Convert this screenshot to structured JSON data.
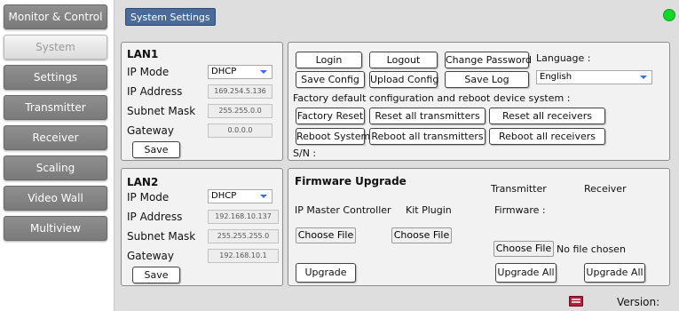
{
  "sidebar": {
    "items": [
      {
        "label": "Monitor & Control"
      },
      {
        "label": "System"
      },
      {
        "label": "Settings"
      },
      {
        "label": "Transmitter"
      },
      {
        "label": "Receiver"
      },
      {
        "label": "Scaling"
      },
      {
        "label": "Video Wall"
      },
      {
        "label": "Multiview"
      }
    ],
    "active": "System"
  },
  "header": {
    "title": "System Settings",
    "status_color": "#16d62a"
  },
  "lan1": {
    "title": "LAN1",
    "ip_mode_label": "IP Mode",
    "ip_mode_value": "DHCP",
    "ip_address_label": "IP Address",
    "ip_address_value": "169.254.5.136",
    "subnet_mask_label": "Subnet Mask",
    "subnet_mask_value": "255.255.0.0",
    "gateway_label": "Gateway",
    "gateway_value": "0.0.0.0",
    "save_label": "Save"
  },
  "lan2": {
    "title": "LAN2",
    "ip_mode_label": "IP Mode",
    "ip_mode_value": "DHCP",
    "ip_address_label": "IP Address",
    "ip_address_value": "192.168.10.137",
    "subnet_mask_label": "Subnet Mask",
    "subnet_mask_value": "255.255.255.0",
    "gateway_label": "Gateway",
    "gateway_value": "192.168.10.1",
    "save_label": "Save"
  },
  "account": {
    "login_label": "Login",
    "logout_label": "Logout",
    "change_password_label": "Change Password",
    "language_label": "Language :",
    "language_value": "English",
    "save_config_label": "Save Config",
    "upload_config_label": "Upload Config",
    "save_log_label": "Save Log",
    "factory_text": "Factory default configuration and reboot device system :",
    "factory_reset_label": "Factory Reset",
    "reset_tx_label": "Reset all transmitters",
    "reset_rx_label": "Reset all receivers",
    "reboot_system_label": "Reboot System",
    "reboot_tx_label": "Reboot all transmitters",
    "reboot_rx_label": "Reboot all receivers",
    "sn_label": "S/N :"
  },
  "firmware": {
    "title": "Firmware Upgrade",
    "transmitter_label": "Transmitter",
    "receiver_label": "Receiver",
    "ip_master_label": "IP Master Controller",
    "kit_plugin_label": "Kit Plugin",
    "firmware_label": "Firmware :",
    "choose_file_label": "Choose File",
    "no_file_text": "No file chosen",
    "upgrade_label": "Upgrade",
    "upgrade_all_label": "Upgrade All"
  },
  "footer": {
    "version_label": "Version:"
  },
  "icons": {
    "keyboard": "keyboard-icon",
    "dropdown": "chevron-down-icon"
  }
}
